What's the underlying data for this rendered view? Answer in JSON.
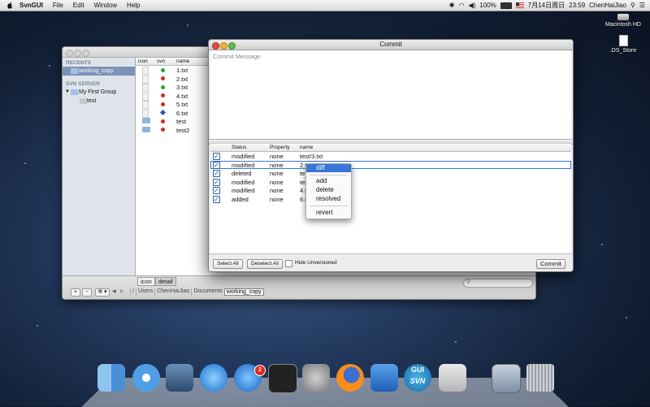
{
  "menubar": {
    "app": "SvnGUI",
    "items": [
      "File",
      "Edit",
      "Window",
      "Help"
    ],
    "status": {
      "battery": "100%",
      "date": "7月14日周日",
      "time": "23:59",
      "user": "ChenHaiJiao"
    }
  },
  "desktop": {
    "icons": [
      "Macintosh HD",
      ".DS_Store"
    ]
  },
  "finder": {
    "sidebar": {
      "recents_header": "RECENTS",
      "recent_item": "working_copy",
      "server_header": "SVN SERVER",
      "group": "My First Group",
      "group_child": "test"
    },
    "columns": {
      "icon": "icon",
      "svn": "svn",
      "name": "name"
    },
    "files": [
      {
        "name": "1.txt",
        "status": "normal",
        "color": "#2aa52a"
      },
      {
        "name": "2.txt",
        "status": "deleted",
        "color": "#d8261f"
      },
      {
        "name": "3.txt",
        "status": "modified",
        "color": "#2aa52a"
      },
      {
        "name": "4.txt",
        "status": "modified",
        "color": "#d8261f"
      },
      {
        "name": "5.txt",
        "status": "modified",
        "color": "#d8261f"
      },
      {
        "name": "6.txt",
        "status": "added",
        "color": "#1f54c9"
      },
      {
        "name": "test",
        "status": "folder",
        "color": "#d8261f"
      },
      {
        "name": "test2",
        "status": "folder",
        "color": "#d8261f"
      }
    ],
    "view_tabs": [
      "icon",
      "detail"
    ],
    "path": [
      "/",
      "Users",
      "ChenHaiJiao",
      "Documents",
      "working_copy"
    ],
    "bottom_buttons": {
      "add": "+",
      "remove": "−",
      "action": "✲ ▾",
      "back": "◀",
      "forward": "▶"
    }
  },
  "commit": {
    "title": "Commit",
    "message_placeholder": "Commit Message",
    "columns": {
      "status": "Status",
      "property": "Property",
      "name": "name"
    },
    "rows": [
      {
        "checked": true,
        "status": "modified",
        "property": "none",
        "name": "test/3.txt"
      },
      {
        "checked": true,
        "status": "modified",
        "property": "none",
        "name": "2.txt"
      },
      {
        "checked": true,
        "status": "deleted",
        "property": "none",
        "name": "te"
      },
      {
        "checked": true,
        "status": "modified",
        "property": "none",
        "name": "tes"
      },
      {
        "checked": true,
        "status": "modified",
        "property": "none",
        "name": "4.t"
      },
      {
        "checked": true,
        "status": "added",
        "property": "none",
        "name": "6.t"
      }
    ],
    "buttons": {
      "select_all": "Select All",
      "deselect_all": "Deselect All",
      "hide_unversioned": "Hide Unversioned",
      "commit": "Commit"
    }
  },
  "context_menu": {
    "items": [
      "diff",
      "add",
      "delete",
      "resolved",
      "revert"
    ],
    "highlighted": "diff"
  },
  "dock": {
    "apps": [
      "Finder",
      "Safari",
      "Preview",
      "iTunes",
      "App Store",
      "Terminal",
      "System Preferences",
      "Firefox",
      "Xcode",
      "SvnGUI",
      "Grab",
      "Screen Sharing",
      "Trash"
    ],
    "app_store_badge": "2",
    "svngui_label_top": "GUI",
    "svngui_label_bottom": "SVN"
  }
}
